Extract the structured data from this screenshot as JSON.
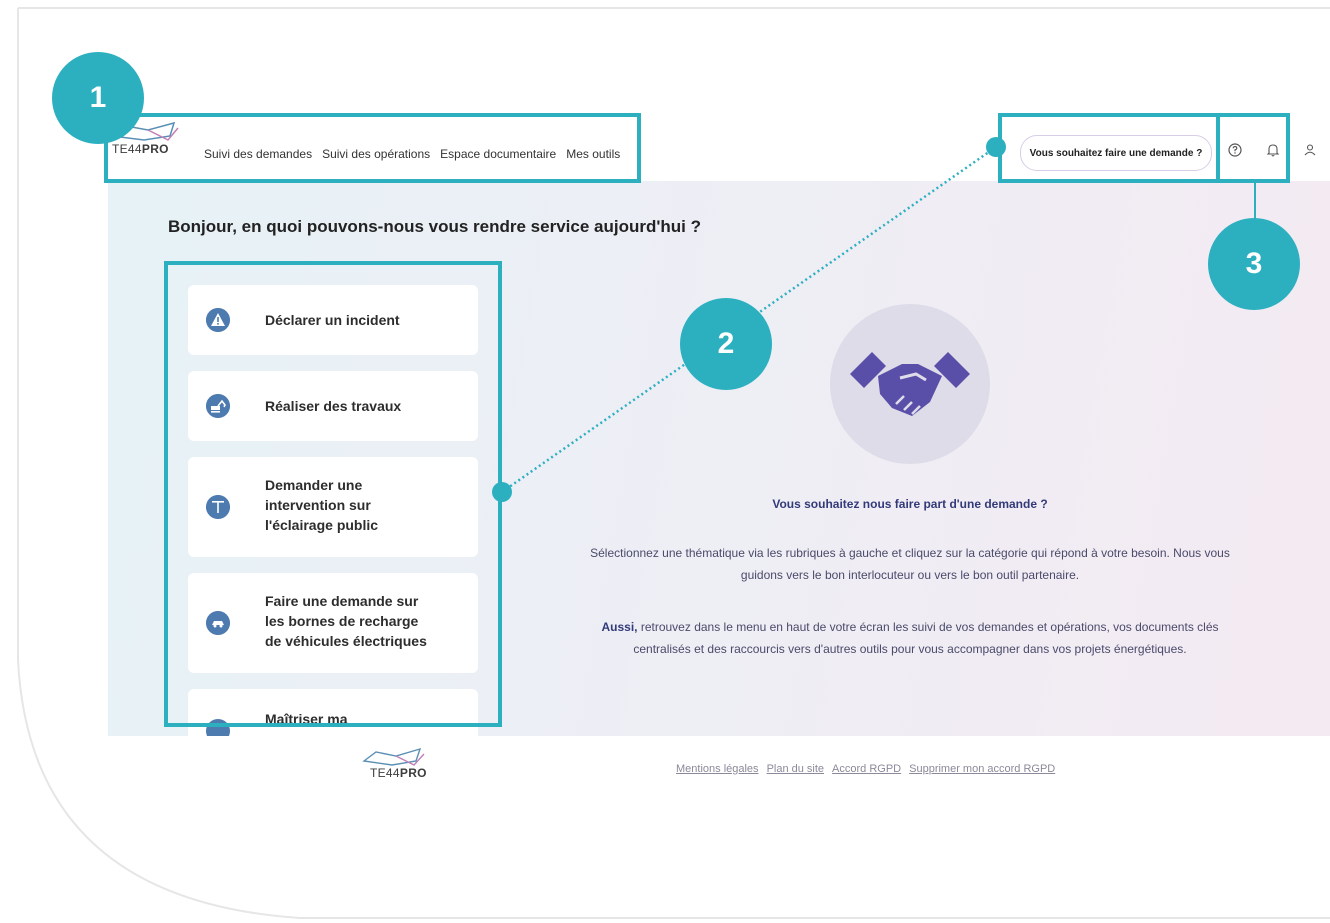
{
  "header": {
    "logo_text_pre": "TE44",
    "logo_text_bold": "PRO",
    "nav": [
      "Suivi des demandes",
      "Suivi des opérations",
      "Espace documentaire",
      "Mes outils"
    ],
    "cta_label": "Vous souhaitez faire une demande ?",
    "icons": [
      "help-icon",
      "bell-icon",
      "user-icon"
    ]
  },
  "main": {
    "greeting": "Bonjour, en quoi pouvons-nous vous rendre service aujourd'hui ?",
    "cards": [
      {
        "label": "Déclarer un incident",
        "icon": "warning-icon"
      },
      {
        "label": "Réaliser des travaux",
        "icon": "excavator-icon"
      },
      {
        "label": "Demander une\nintervention sur\nl'éclairage public",
        "icon": "streetlight-icon"
      },
      {
        "label": "Faire une demande sur\nles bornes de recharge\nde véhicules électriques",
        "icon": "car-charging-icon"
      },
      {
        "label": "Maîtriser ma",
        "icon": "energy-icon"
      }
    ],
    "info_title": "Vous souhaitez nous faire part d'une demande ?",
    "info_p1": "Sélectionnez une thématique via les rubriques à gauche et cliquez sur la catégorie qui répond à votre besoin. Nous vous guidons vers le bon interlocuteur ou vers le bon outil partenaire.",
    "info_p2_bold": "Aussi,",
    "info_p2": " retrouvez dans le menu en haut de votre écran les suivi de vos demandes et opérations, vos documents clés centralisés et des raccourcis vers d'autres outils pour vous accompagner dans vos projets énergétiques."
  },
  "footer": {
    "logo_text_pre": "TE44",
    "logo_text_bold": "PRO",
    "links": [
      "Mentions légales",
      "Plan du site",
      "Accord RGPD",
      "Supprimer mon accord RGPD"
    ]
  },
  "callouts": [
    "1",
    "2",
    "3"
  ],
  "colors": {
    "accent": "#2cb0c0",
    "icon_blue": "#4d7aaf",
    "hand_purple": "#5a4fa8",
    "title_navy": "#333a7a"
  }
}
